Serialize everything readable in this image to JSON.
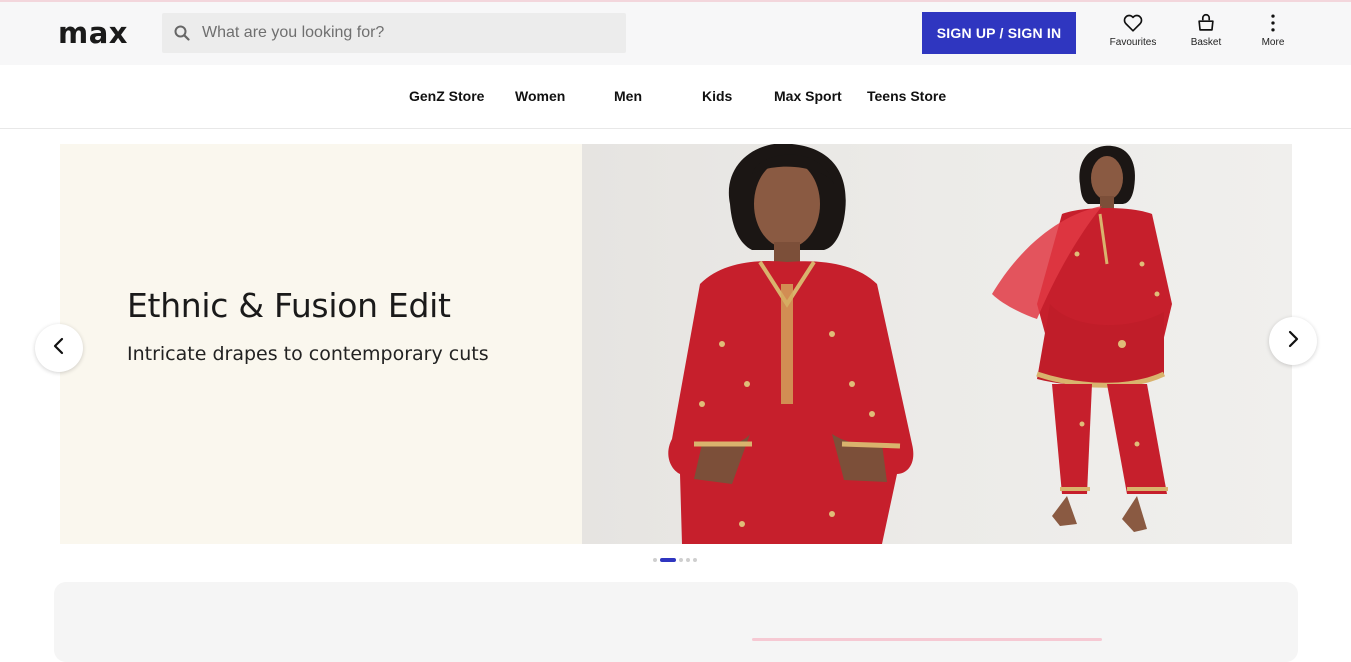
{
  "header": {
    "logo": "max",
    "search_placeholder": "What are you looking for?",
    "signin_label": "SIGN UP / SIGN IN",
    "favourites_label": "Favourites",
    "basket_label": "Basket",
    "more_label": "More"
  },
  "nav": {
    "items": [
      {
        "label": "GenZ Store"
      },
      {
        "label": "Women"
      },
      {
        "label": "Men"
      },
      {
        "label": "Kids"
      },
      {
        "label": "Max Sport"
      },
      {
        "label": "Teens Store"
      }
    ]
  },
  "banner": {
    "title": "Ethnic & Fusion Edit",
    "subtitle": "Intricate drapes to contemporary cuts",
    "slide_active": 2,
    "slide_count": 5
  },
  "colors": {
    "accent": "#2f36c0",
    "banner_bg": "#faf7ee",
    "outfit_red": "#c8202e"
  },
  "icons": {
    "search": "search-icon",
    "favourites": "heart-icon",
    "basket": "basket-icon",
    "more": "more-vertical-icon",
    "prev": "chevron-left-icon",
    "next": "chevron-right-icon"
  }
}
